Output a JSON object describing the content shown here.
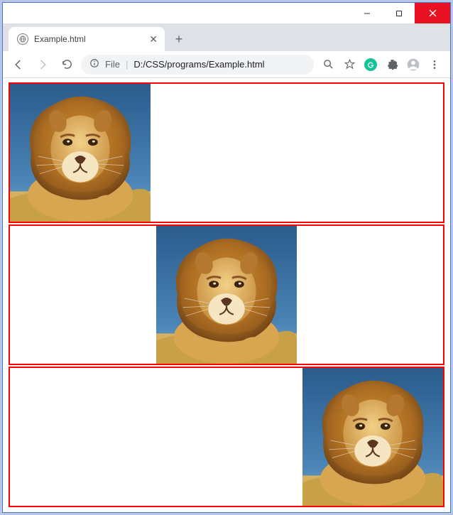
{
  "window": {
    "minimize_tip": "Minimize",
    "maximize_tip": "Maximize",
    "close_tip": "Close"
  },
  "tab": {
    "title": "Example.html",
    "close_tip": "Close tab",
    "newtab_tip": "New tab"
  },
  "toolbar": {
    "back_tip": "Back",
    "forward_tip": "Forward",
    "reload_tip": "Reload",
    "info_tip": "View site information",
    "file_label": "File",
    "url": "D:/CSS/programs/Example.html",
    "zoom_tip": "Zoom",
    "star_tip": "Bookmark this tab",
    "grammarly_tip": "Grammarly",
    "extensions_tip": "Extensions",
    "profile_tip": "Profile",
    "menu_tip": "Customize and control"
  },
  "content": {
    "boxes": [
      {
        "align": "left"
      },
      {
        "align": "center"
      },
      {
        "align": "right"
      }
    ]
  }
}
